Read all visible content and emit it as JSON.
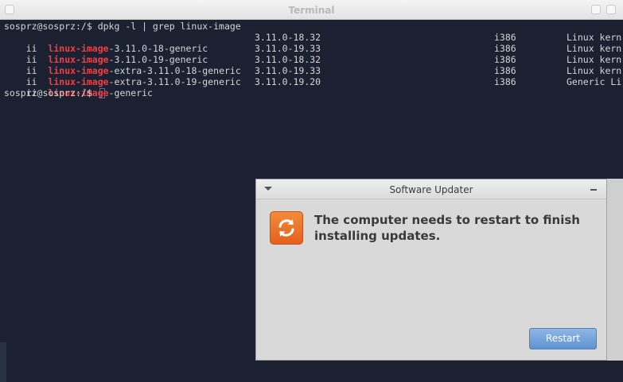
{
  "terminal": {
    "title": "Terminal",
    "command_line": "sosprz@sosprz:/$ dpkg -l | grep linux-image",
    "prompt": "sosprz@sosprz:/$ ",
    "rows": [
      {
        "status": "ii",
        "hl": "linux-image",
        "rest": "-3.11.0-18-generic",
        "version": "3.11.0-18.32",
        "arch": "i386",
        "desc": "Linux kern"
      },
      {
        "status": "ii",
        "hl": "linux-image",
        "rest": "-3.11.0-19-generic",
        "version": "3.11.0-19.33",
        "arch": "i386",
        "desc": "Linux kern"
      },
      {
        "status": "ii",
        "hl": "linux-image",
        "rest": "-extra-3.11.0-18-generic",
        "version": "3.11.0-18.32",
        "arch": "i386",
        "desc": "Linux kern"
      },
      {
        "status": "ii",
        "hl": "linux-image",
        "rest": "-extra-3.11.0-19-generic",
        "version": "3.11.0-19.33",
        "arch": "i386",
        "desc": "Linux kern"
      },
      {
        "status": "ii",
        "hl": "linux-image",
        "rest": "-generic",
        "version": "3.11.0.19.20",
        "arch": "i386",
        "desc": "Generic Li"
      }
    ]
  },
  "dialog": {
    "title": "Software Updater",
    "message": "The computer needs to restart to finish installing updates.",
    "restart_label": "Restart",
    "icon": "refresh-icon",
    "accent": "#e4601c"
  }
}
